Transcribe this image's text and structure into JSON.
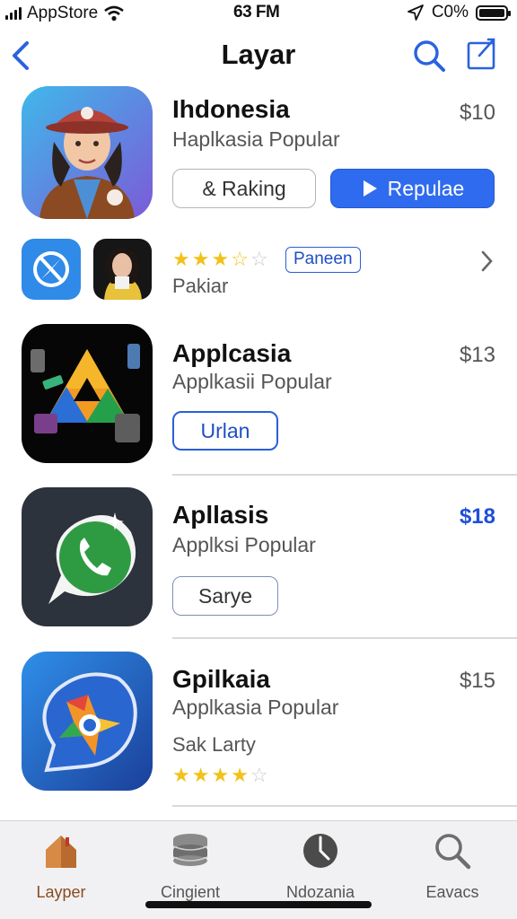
{
  "status_bar": {
    "carrier": "AppStore",
    "time": "63 FM",
    "battery": "C0%"
  },
  "nav": {
    "title": "Layar"
  },
  "featured": {
    "name": "Ihdonesia",
    "subtitle": "Haplkasia Popular",
    "price": "$10",
    "secondary_button": "& Raking",
    "primary_button": "Repulae",
    "rating_stars": 3.5,
    "badge": "Paneen",
    "caption": "Pakiar"
  },
  "apps": [
    {
      "name": "Applcasia",
      "subtitle": "Applkasii Popular",
      "price": "$13",
      "button": "Urlan"
    },
    {
      "name": "Apllasis",
      "subtitle": "Applksi Popular",
      "price": "$18",
      "button": "Sarye"
    },
    {
      "name": "Gpilkaia",
      "subtitle": "Applkasia Popular",
      "price": "$15",
      "caption": "Sak Larty",
      "rating_stars": 4
    }
  ],
  "tabs": [
    {
      "label": "Layper",
      "icon": "house-icon",
      "active": true
    },
    {
      "label": "Cingient",
      "icon": "stack-icon",
      "active": false
    },
    {
      "label": "Ndozania",
      "icon": "clock-icon",
      "active": false
    },
    {
      "label": "Eavacs",
      "icon": "search-icon",
      "active": false
    }
  ],
  "colors": {
    "accent": "#2f6bef",
    "price_highlight": "#1f4fd6",
    "star": "#f2c21b",
    "active_tab": "#8a4b1d"
  }
}
